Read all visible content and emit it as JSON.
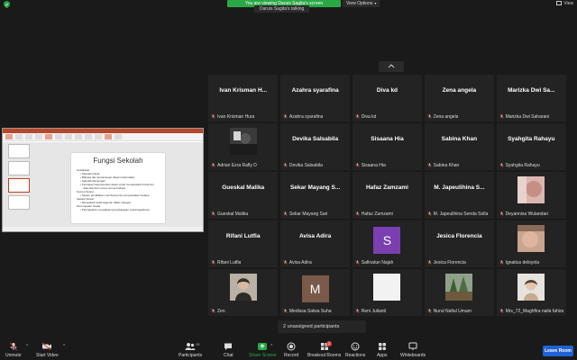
{
  "topbar": {
    "share_banner": "You are viewing Daruis Sagita's screen",
    "view_options": "View Options",
    "speaker_tag": "Daruis Sagita's talking",
    "view_label": "View"
  },
  "shared_screen": {
    "slide_title": "Fungsi Sekolah",
    "slide_lines": [
      {
        "level": 1,
        "text": "Sosialisasi"
      },
      {
        "level": 2,
        "text": "• Sekolah Dasar"
      },
      {
        "level": 2,
        "text": "• Bahasa dan kemampuan dasar-matematika"
      },
      {
        "level": 2,
        "text": "• Sekolah Menengah"
      },
      {
        "level": 2,
        "text": "• Persiapan keterampilan dasar untuk memasukkan transmisi"
      },
      {
        "level": 3,
        "text": "nilai-nilai dan norma-norma budaya"
      },
      {
        "level": 1,
        "text": "Kontrol Sosial"
      },
      {
        "level": 2,
        "text": "• Sistem pendidikan membuat jenis menyebarkan budaya"
      },
      {
        "level": 1,
        "text": "Seleksi Sosial"
      },
      {
        "level": 2,
        "text": "• Menseleksi keberagaman dalam bangsa"
      },
      {
        "level": 1,
        "text": "Penempatan Sosial"
      },
      {
        "level": 2,
        "text": "• Peningkatan mentalisasi (penghargaan sosial kejahtera)"
      }
    ]
  },
  "gallery": {
    "tiles": [
      {
        "type": "name",
        "center": "Ivan Krisman H...",
        "label": "Ivan Krisman Hura"
      },
      {
        "type": "name",
        "center": "Azahra syarafina",
        "label": "Azahra syarafina"
      },
      {
        "type": "name",
        "center": "Diva kd",
        "label": "Diva kd"
      },
      {
        "type": "name",
        "center": "Zena angela",
        "label": "Zena angela"
      },
      {
        "type": "name",
        "center": "Marizka Dwi Sa...",
        "label": "Marizka Dwi Saharani"
      },
      {
        "type": "video",
        "label": "Adrian Ezra Rafly D",
        "video": "dark-photo"
      },
      {
        "type": "name",
        "center": "Devika Salsabila",
        "label": "Devika Salsabila"
      },
      {
        "type": "name",
        "center": "Sisaana Hia",
        "label": "Sisaana Hia"
      },
      {
        "type": "name",
        "center": "Sabina Khan",
        "label": "Sabina Khan"
      },
      {
        "type": "name",
        "center": "Syahgita Rahayu",
        "label": "Syahgita Rahayu"
      },
      {
        "type": "name",
        "center": "Gueskal Malika",
        "label": "Gueskal Malika"
      },
      {
        "type": "name",
        "center": "Sekar Mayang S...",
        "label": "Sekar Mayang Sari"
      },
      {
        "type": "name",
        "center": "Hafaz Zamzami",
        "label": "Hafaz Zamzami"
      },
      {
        "type": "name",
        "center": "M. Japeulihina S...",
        "label": "M. Japeulihina Senda Solla"
      },
      {
        "type": "video",
        "label": "Deyannisa Wulandari",
        "video": "pink-blur"
      },
      {
        "type": "name",
        "center": "Rifani Lutfia",
        "label": "Rifani Lutfia"
      },
      {
        "type": "name",
        "center": "Avisa Adira",
        "label": "Avisa Adira"
      },
      {
        "type": "letter",
        "letter": "S",
        "color": "#7b3fb0",
        "label": "Safinatun Najah"
      },
      {
        "type": "name",
        "center": "Jesica Florencia",
        "label": "Jesica Florencia"
      },
      {
        "type": "video",
        "label": "Ignatius deloyola",
        "video": "warm-photo"
      },
      {
        "type": "video",
        "label": "Zen",
        "video": "portrait-girl"
      },
      {
        "type": "letter",
        "letter": "M",
        "color": "#7a5a48",
        "label": "Medissa Salwa Suha"
      },
      {
        "type": "video",
        "label": "Reni Julianti",
        "video": "white-blank"
      },
      {
        "type": "video",
        "label": "Nurul Nafiul Umam",
        "video": "trees"
      },
      {
        "type": "video",
        "label": "Mrs_72_Maghfira naila fahira",
        "video": "portrait-light"
      }
    ]
  },
  "unassigned": "2 unassigned participants",
  "toolbar": {
    "unmute": "Unmute",
    "start_video": "Start Video",
    "participants": "Participants",
    "participants_count": "28",
    "chat": "Chat",
    "share_screen": "Share Screen",
    "record": "Record",
    "breakout_rooms": "Breakout Rooms",
    "breakout_badge": "2",
    "reactions": "Reactions",
    "apps": "Apps",
    "whiteboards": "Whiteboards",
    "leave_room": "Leave Room"
  },
  "colors": {
    "accent_green": "#2aa846",
    "leave_blue": "#1f62d6",
    "muted_red": "#d9453b",
    "tile_bg": "#232323"
  }
}
